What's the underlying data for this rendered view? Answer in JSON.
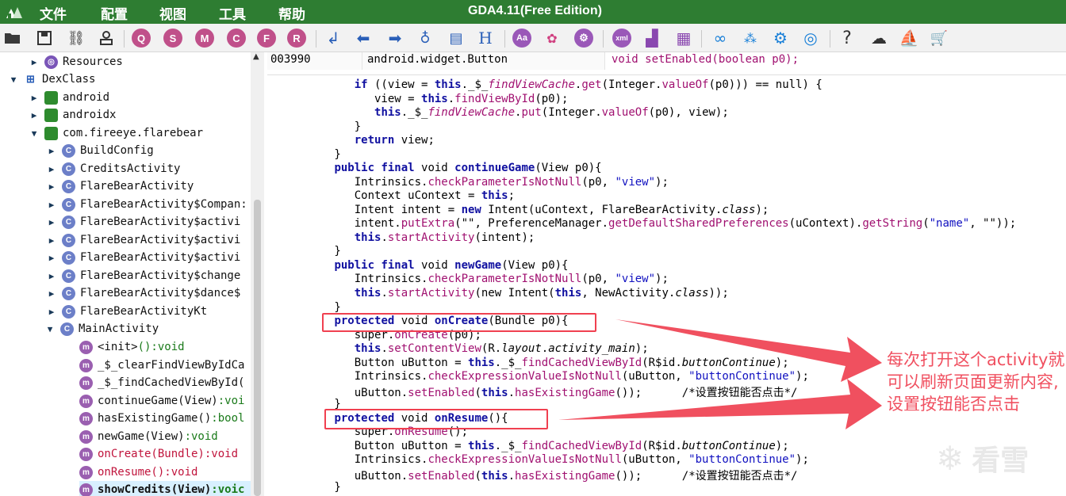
{
  "titlebar": {
    "menus": [
      "文件",
      "配置",
      "视图",
      "工具",
      "帮助"
    ],
    "app_title": "GDA4.11(Free Edition)"
  },
  "toolbar": {
    "letter_buttons": [
      "Q",
      "S",
      "M",
      "C",
      "F",
      "R"
    ],
    "aa_label": "Aa",
    "xml_label": "xml",
    "h_label": "H",
    "help_label": "?"
  },
  "tree": {
    "items": [
      {
        "label": "Resources",
        "icon": "resource-icon",
        "arrow": "right"
      },
      {
        "label": "DexClass",
        "icon": "dex-icon",
        "arrow": "down"
      },
      {
        "label": "android",
        "icon": "package-icon",
        "arrow": "right"
      },
      {
        "label": "androidx",
        "icon": "package-icon",
        "arrow": "right"
      },
      {
        "label": "com.fireeye.flarebear",
        "icon": "package-icon",
        "arrow": "down"
      },
      {
        "label": "BuildConfig",
        "icon": "class-icon",
        "arrow": "right"
      },
      {
        "label": "CreditsActivity",
        "icon": "class-icon",
        "arrow": "right"
      },
      {
        "label": "FlareBearActivity",
        "icon": "class-icon",
        "arrow": "right"
      },
      {
        "label": "FlareBearActivity$Compan:",
        "icon": "class-icon",
        "arrow": "right"
      },
      {
        "label": "FlareBearActivity$activi",
        "icon": "class-icon",
        "arrow": "right"
      },
      {
        "label": "FlareBearActivity$activi",
        "icon": "class-icon",
        "arrow": "right"
      },
      {
        "label": "FlareBearActivity$activi",
        "icon": "class-icon",
        "arrow": "right"
      },
      {
        "label": "FlareBearActivity$change",
        "icon": "class-icon",
        "arrow": "right"
      },
      {
        "label": "FlareBearActivity$dance$",
        "icon": "class-icon",
        "arrow": "right"
      },
      {
        "label": "FlareBearActivityKt",
        "icon": "class-icon",
        "arrow": "right"
      },
      {
        "label": "MainActivity",
        "icon": "class-icon",
        "arrow": "down"
      }
    ],
    "methods": [
      {
        "name": "<init>",
        "sig": "():void"
      },
      {
        "name": "_$_clearFindViewByIdCa",
        "sig": ""
      },
      {
        "name": "_$_findCachedViewById(",
        "sig": ""
      },
      {
        "name": "continueGame(View)",
        "sig": ":voi"
      },
      {
        "name": "hasExistingGame()",
        "sig": ":bool"
      },
      {
        "name": "newGame(View)",
        "sig": ":void"
      },
      {
        "name": "onCreate(Bundle)",
        "sig": ":void"
      },
      {
        "name": "onResume()",
        "sig": ":void"
      },
      {
        "name": "showCredits(View)",
        "sig": ":voic"
      }
    ]
  },
  "code_header": {
    "offset": "003990",
    "class": "android.widget.Button",
    "method": "void setEnabled(boolean p0);"
  },
  "code": {
    "lines": [
      [
        "    ",
        [
          "kw",
          "if"
        ],
        " ((view = ",
        [
          "kw",
          "this"
        ],
        "._$_",
        [
          "mt it",
          "findViewCache"
        ],
        ".",
        [
          "mt",
          "get"
        ],
        "(Integer.",
        [
          "mt",
          "valueOf"
        ],
        "(p0))) == null) {"
      ],
      [
        "       view = ",
        [
          "kw",
          "this"
        ],
        ".",
        [
          "mt",
          "findViewById"
        ],
        "(p0);"
      ],
      [
        "       ",
        [
          "kw",
          "this"
        ],
        "._$_",
        [
          "mt it",
          "findViewCache"
        ],
        ".",
        [
          "mt",
          "put"
        ],
        "(Integer.",
        [
          "mt",
          "valueOf"
        ],
        "(p0), view);"
      ],
      [
        "    }"
      ],
      [
        "    ",
        [
          "kw",
          "return"
        ],
        " view;"
      ],
      [
        " }"
      ],
      [
        " ",
        [
          "kw",
          "public final"
        ],
        " void ",
        [
          "kw",
          "continueGame"
        ],
        "(View p0){"
      ],
      [
        "    Intrinsics.",
        [
          "mt",
          "checkParameterIsNotNull"
        ],
        "(p0, ",
        [
          "st",
          "\"view\""
        ],
        ");"
      ],
      [
        "    Context uContext = ",
        [
          "kw",
          "this"
        ],
        ";"
      ],
      [
        "    Intent intent = ",
        [
          "kw",
          "new"
        ],
        " Intent(uContext, FlareBearActivity.",
        [
          "it",
          "class"
        ],
        ");"
      ],
      [
        "    intent.",
        [
          "mt",
          "putExtra"
        ],
        "(\"\", PreferenceManager.",
        [
          "mt",
          "getDefaultSharedPreferences"
        ],
        "(uContext).",
        [
          "mt",
          "getString"
        ],
        "(",
        [
          "st",
          "\"name\""
        ],
        ", \"\"));"
      ],
      [
        "    ",
        [
          "kw",
          "this"
        ],
        ".",
        [
          "mt",
          "startActivity"
        ],
        "(intent);"
      ],
      [
        " }"
      ],
      [
        " ",
        [
          "kw",
          "public final"
        ],
        " void ",
        [
          "kw",
          "newGame"
        ],
        "(View p0){"
      ],
      [
        "    Intrinsics.",
        [
          "mt",
          "checkParameterIsNotNull"
        ],
        "(p0, ",
        [
          "st",
          "\"view\""
        ],
        ");"
      ],
      [
        "    ",
        [
          "kw",
          "this"
        ],
        ".",
        [
          "mt",
          "startActivity"
        ],
        "(new Intent(",
        [
          "kw",
          "this"
        ],
        ", NewActivity.",
        [
          "it",
          "class"
        ],
        "));"
      ],
      [
        " }"
      ],
      [
        " ",
        [
          "kw",
          "protected"
        ],
        " void ",
        [
          "kw",
          "onCreate"
        ],
        "(Bundle p0){"
      ],
      [
        "    super.",
        [
          "mt",
          "onCreate"
        ],
        "(p0);"
      ],
      [
        "    ",
        [
          "kw",
          "this"
        ],
        ".",
        [
          "mt",
          "setContentView"
        ],
        "(R.",
        [
          "it",
          "layout"
        ],
        ".",
        [
          "it",
          "activity_main"
        ],
        ");"
      ],
      [
        "    Button uButton = ",
        [
          "kw",
          "this"
        ],
        "._$_",
        [
          "mt",
          "findCachedViewById"
        ],
        "(R$id.",
        [
          "it",
          "buttonContinue"
        ],
        ");"
      ],
      [
        "    Intrinsics.",
        [
          "mt",
          "checkExpressionValueIsNotNull"
        ],
        "(uButton, ",
        [
          "st",
          "\"buttonContinue\""
        ],
        ");"
      ],
      [
        "    uButton.",
        [
          "mt",
          "setEnabled"
        ],
        "(",
        [
          "kw",
          "this"
        ],
        ".",
        [
          "mt",
          "hasExistingGame"
        ],
        "());      /*设置按钮能否点击*/"
      ],
      [
        " }"
      ],
      [
        " ",
        [
          "kw",
          "protected"
        ],
        " void ",
        [
          "kw",
          "onResume"
        ],
        "(){"
      ],
      [
        "    super.",
        [
          "mt",
          "onResume"
        ],
        "();"
      ],
      [
        "    Button uButton = ",
        [
          "kw",
          "this"
        ],
        "._$_",
        [
          "mt",
          "findCachedViewById"
        ],
        "(R$id.",
        [
          "it",
          "buttonContinue"
        ],
        ");"
      ],
      [
        "    Intrinsics.",
        [
          "mt",
          "checkExpressionValueIsNotNull"
        ],
        "(uButton, ",
        [
          "st",
          "\"buttonContinue\""
        ],
        ");"
      ],
      [
        "    uButton.",
        [
          "mt",
          "setEnabled"
        ],
        "(",
        [
          "kw",
          "this"
        ],
        ".",
        [
          "mt",
          "hasExistingGame"
        ],
        "());      /*设置按钮能否点击*/"
      ],
      [
        " }"
      ]
    ]
  },
  "annotation": {
    "note": "每次打开这个activity就可以刷新页面更新内容,设置按钮能否点击",
    "watermark": "看雪"
  },
  "colors": {
    "titlebar": "#2e7d32",
    "annotation": "#f04050"
  }
}
